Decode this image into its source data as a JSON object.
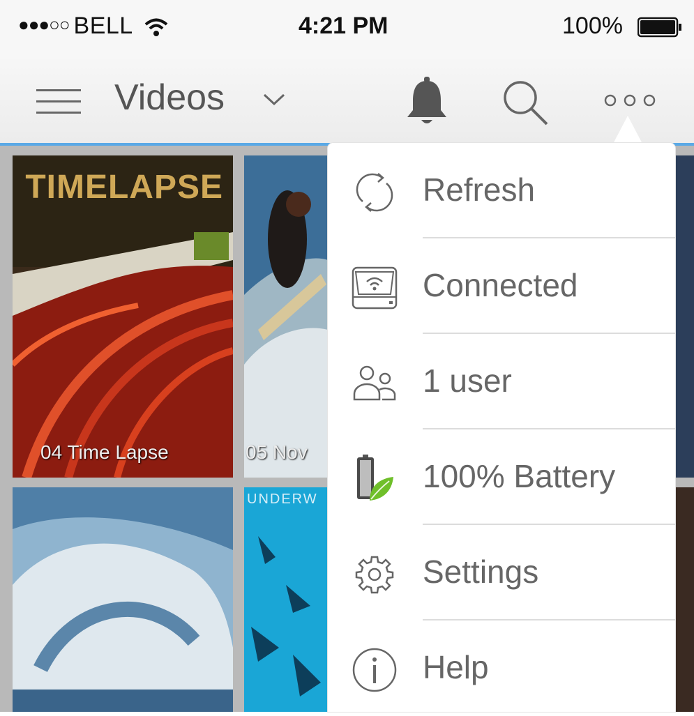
{
  "status_bar": {
    "signal_dots": "●●●○○",
    "carrier": "BELL",
    "time": "4:21 PM",
    "battery": "100%"
  },
  "nav": {
    "title": "Videos"
  },
  "tiles": [
    {
      "brand": "TIMELAPSE",
      "caption": "04 Time Lapse"
    },
    {
      "caption": "05 Nov"
    },
    {
      "brand": "UNDERW"
    }
  ],
  "menu": {
    "items": [
      {
        "icon": "refresh-icon",
        "label": "Refresh"
      },
      {
        "icon": "drive-wifi-icon",
        "label": "Connected"
      },
      {
        "icon": "users-icon",
        "label": "1 user"
      },
      {
        "icon": "battery-leaf-icon",
        "label": "100% Battery"
      },
      {
        "icon": "gear-icon",
        "label": "Settings"
      },
      {
        "icon": "info-icon",
        "label": "Help"
      }
    ]
  },
  "colors": {
    "accent": "#5aa9e6",
    "leaf": "#6fbf2a",
    "menu_text": "#666666"
  }
}
